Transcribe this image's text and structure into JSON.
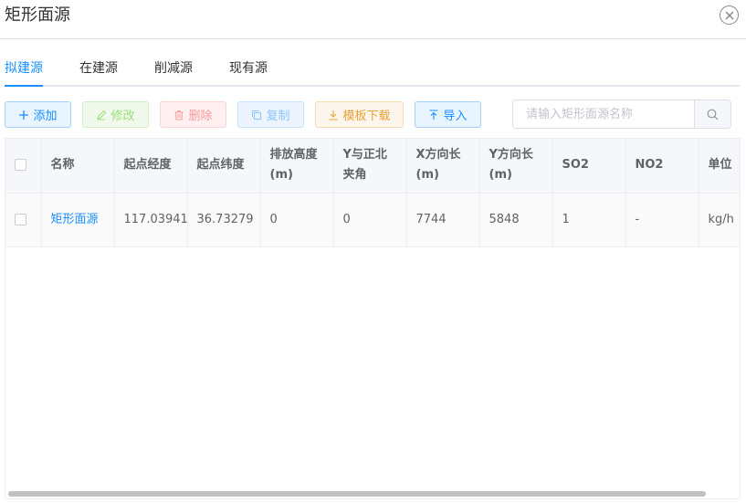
{
  "dialog": {
    "title": "矩形面源"
  },
  "tabs": [
    {
      "label": "拟建源",
      "active": true
    },
    {
      "label": "在建源",
      "active": false
    },
    {
      "label": "削减源",
      "active": false
    },
    {
      "label": "现有源",
      "active": false
    }
  ],
  "toolbar": {
    "add_label": "添加",
    "edit_label": "修改",
    "delete_label": "删除",
    "copy_label": "复制",
    "template_download_label": "模板下载",
    "import_label": "导入"
  },
  "search": {
    "placeholder": "请输入矩形面源名称",
    "value": ""
  },
  "table": {
    "headers": {
      "name": "名称",
      "start_lon": "起点经度",
      "start_lat": "起点纬度",
      "emission_height": "排放高度(m)",
      "y_angle": "Y与正北夹角",
      "x_length": "X方向长(m)",
      "y_length": "Y方向长(m)",
      "so2": "SO2",
      "no2": "NO2",
      "unit": "单位"
    },
    "rows": [
      {
        "name": "矩形面源",
        "start_lon": "117.03941",
        "start_lat": "36.73279",
        "emission_height": "0",
        "y_angle": "0",
        "x_length": "7744",
        "y_length": "5848",
        "so2": "1",
        "no2": "-",
        "unit": "kg/h"
      }
    ]
  },
  "colors": {
    "primary": "#1890ff",
    "success": "#9be07a",
    "danger": "#f69c9c",
    "info": "#8cc5ff",
    "warning": "#e6a23c"
  }
}
